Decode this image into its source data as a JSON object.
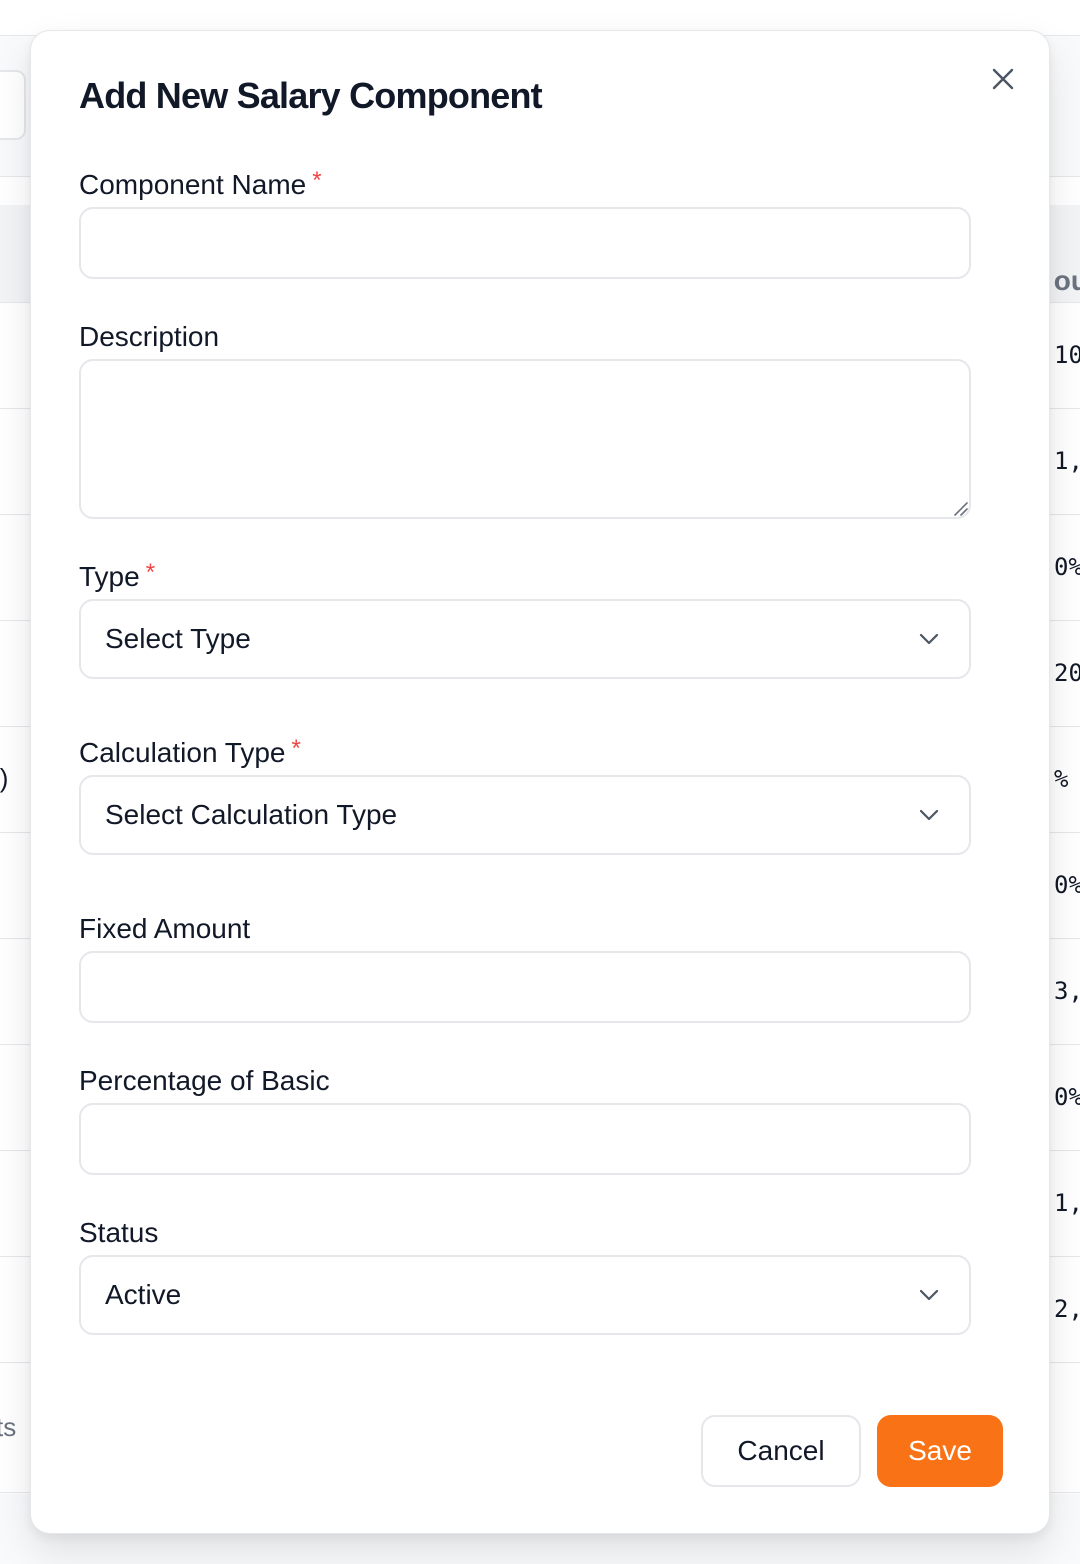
{
  "background": {
    "table_header_fragment": "ou",
    "right_cells": [
      "10",
      "1,",
      "0%",
      "20",
      "%",
      "0%",
      "3,",
      "0%",
      "1,",
      "2,"
    ],
    "left_cell_fragment": "l)",
    "footer_fragment": "ts"
  },
  "modal": {
    "title": "Add New Salary Component",
    "close_icon": "close-icon",
    "fields": {
      "component_name": {
        "label": "Component Name",
        "required_mark": "*",
        "value": "",
        "placeholder": ""
      },
      "description": {
        "label": "Description",
        "value": "",
        "placeholder": ""
      },
      "type": {
        "label": "Type",
        "required_mark": "*",
        "selected": "Select Type"
      },
      "calculation_type": {
        "label": "Calculation Type",
        "required_mark": "*",
        "selected": "Select Calculation Type"
      },
      "fixed_amount": {
        "label": "Fixed Amount",
        "value": "",
        "placeholder": ""
      },
      "percentage_of_basic": {
        "label": "Percentage of Basic",
        "value": "",
        "placeholder": ""
      },
      "status": {
        "label": "Status",
        "selected": "Active"
      }
    },
    "buttons": {
      "cancel": "Cancel",
      "save": "Save"
    },
    "colors": {
      "accent": "#f97316",
      "required": "#ef4444",
      "border": "#e5e7eb"
    }
  }
}
